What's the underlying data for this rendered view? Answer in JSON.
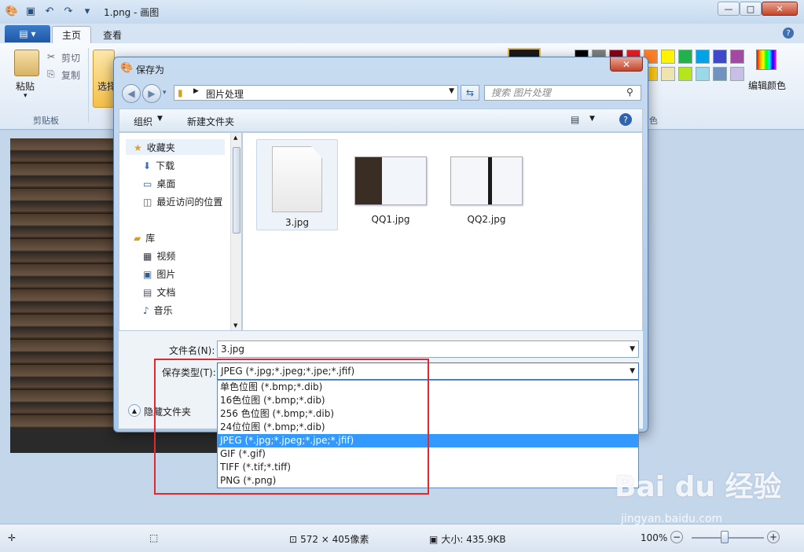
{
  "window": {
    "title": "1.png - 画图"
  },
  "ribbon": {
    "file_tab": "▤ ▾",
    "tabs": [
      {
        "label": "主页"
      },
      {
        "label": "查看"
      }
    ],
    "clipboard": {
      "paste": "粘贴",
      "cut": "剪切",
      "copy": "复制",
      "group_label": "剪贴板"
    },
    "select_label": "选择",
    "edit_colors": "编辑颜色",
    "colors_group_tail": "色",
    "palette": [
      "#000000",
      "#7f7f7f",
      "#880015",
      "#ed1c24",
      "#ff7f27",
      "#fff200",
      "#22b14c",
      "#00a2e8",
      "#3f48cc",
      "#a349a4",
      "#ffffff",
      "#c3c3c3",
      "#b97a57",
      "#ffaec9",
      "#ffc90e",
      "#efe4b0",
      "#b5e61d",
      "#99d9ea",
      "#7092be",
      "#c8bfe7"
    ]
  },
  "dialog": {
    "title": "保存为",
    "address": "图片处理",
    "search_placeholder": "搜索 图片处理",
    "toolbar": {
      "organize": "组织",
      "new_folder": "新建文件夹"
    },
    "nav": {
      "favorites": "收藏夹",
      "download": "下载",
      "desktop": "桌面",
      "recent": "最近访问的位置",
      "library": "库",
      "video": "视频",
      "pictures": "图片",
      "documents": "文档",
      "music": "音乐"
    },
    "files": [
      {
        "name": "3.jpg"
      },
      {
        "name": "QQ1.jpg"
      },
      {
        "name": "QQ2.jpg"
      }
    ],
    "filename_label": "文件名(N):",
    "filename_value": "3.jpg",
    "filetype_label": "保存类型(T):",
    "filetype_value": "JPEG (*.jpg;*.jpeg;*.jpe;*.jfif)",
    "hide_folders": "隐藏文件夹",
    "filetype_options": [
      "单色位图 (*.bmp;*.dib)",
      "16色位图 (*.bmp;*.dib)",
      "256 色位图 (*.bmp;*.dib)",
      "24位位图 (*.bmp;*.dib)",
      "JPEG (*.jpg;*.jpeg;*.jpe;*.jfif)",
      "GIF (*.gif)",
      "TIFF (*.tif;*.tiff)",
      "PNG (*.png)"
    ],
    "selected_option_index": 4
  },
  "statusbar": {
    "dimensions": "572 × 405像素",
    "size": "大小: 435.9KB",
    "zoom": "100%"
  },
  "watermark": {
    "brand": "Bai du 经验",
    "url": "jingyan.baidu.com"
  }
}
